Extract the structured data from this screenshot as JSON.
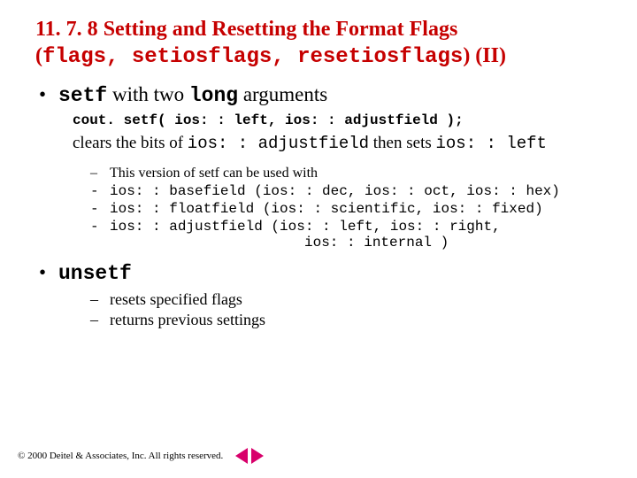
{
  "title": {
    "section_no": "11. 7. 8",
    "plain": " Setting and Resetting the Format Flags",
    "paren_open": "(",
    "flags": "flags",
    "sep1": ", ",
    "setios": "setiosflags",
    "sep2": ", ",
    "resetios": "resetiosflags",
    "paren_close_suffix": ") (II)"
  },
  "bullet1": {
    "setf": "setf",
    "mid": " with two ",
    "long": "long",
    "end": " arguments"
  },
  "code1": "cout. setf( ios: : left, ios: : adjustfield );",
  "para1": {
    "t1": "clears the bits of ",
    "c1": "ios: : adjustfield",
    "t2": " then sets  ",
    "c2": "ios: : left"
  },
  "sub": {
    "s1": "This version of setf can be used with",
    "s2": "ios: : basefield (ios: : dec, ios: : oct, ios: : hex)",
    "s3": "ios: : floatfield (ios: : scientific, ios: : fixed)",
    "s4a": "ios: : adjustfield (ios: : left, ios: : right,",
    "s4b": "ios: : internal )"
  },
  "bullet2": {
    "unsetf": "unsetf"
  },
  "sub2": {
    "a": "resets specified flags",
    "b": "returns previous settings"
  },
  "footer": "© 2000 Deitel & Associates, Inc.  All rights reserved."
}
